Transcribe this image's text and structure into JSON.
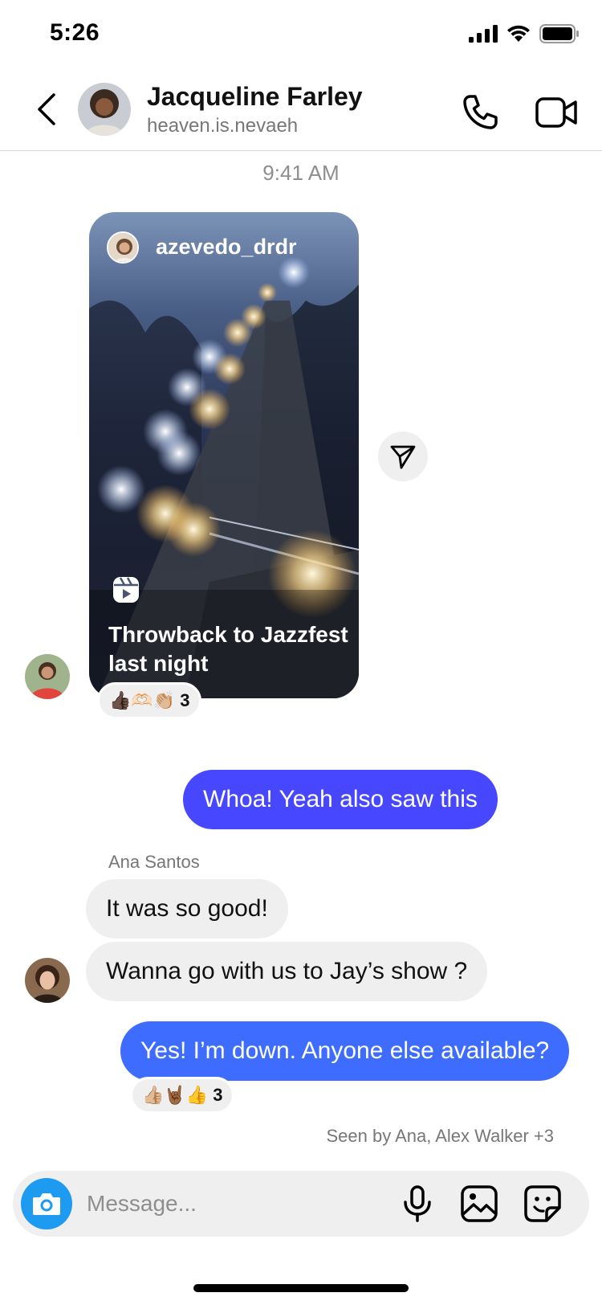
{
  "status_bar": {
    "time": "5:26"
  },
  "header": {
    "name": "Jacqueline Farley",
    "username": "heaven.is.nevaeh"
  },
  "timestamp": "9:41 AM",
  "shared_reel": {
    "owner": "azevedo_drdr",
    "caption": "Throwback to Jazzfest last night",
    "reactions": {
      "emojis": "👍🏿🫶🏻👏🏼",
      "count": "3"
    }
  },
  "messages": [
    {
      "from": "me",
      "text": "Whoa! Yeah also saw this",
      "color": "#4747ff"
    },
    {
      "from": "Ana Santos",
      "text": "It was so good!"
    },
    {
      "from": "Ana Santos",
      "text": "Wanna go with us to Jay’s show ?"
    },
    {
      "from": "me",
      "text": "Yes! I’m down. Anyone else available?",
      "color": "#3e6cff",
      "reactions": {
        "emojis": "👍🏼🤘🏾👍",
        "count": "3"
      }
    }
  ],
  "sender_label": "Ana Santos",
  "seen_by": "Seen by Ana, Alex Walker +3",
  "composer": {
    "placeholder": "Message..."
  },
  "colors": {
    "outgoing_primary": "#4747ff",
    "outgoing_secondary": "#3e6cff",
    "camera": "#1d9bf0",
    "incoming": "#efefef"
  }
}
